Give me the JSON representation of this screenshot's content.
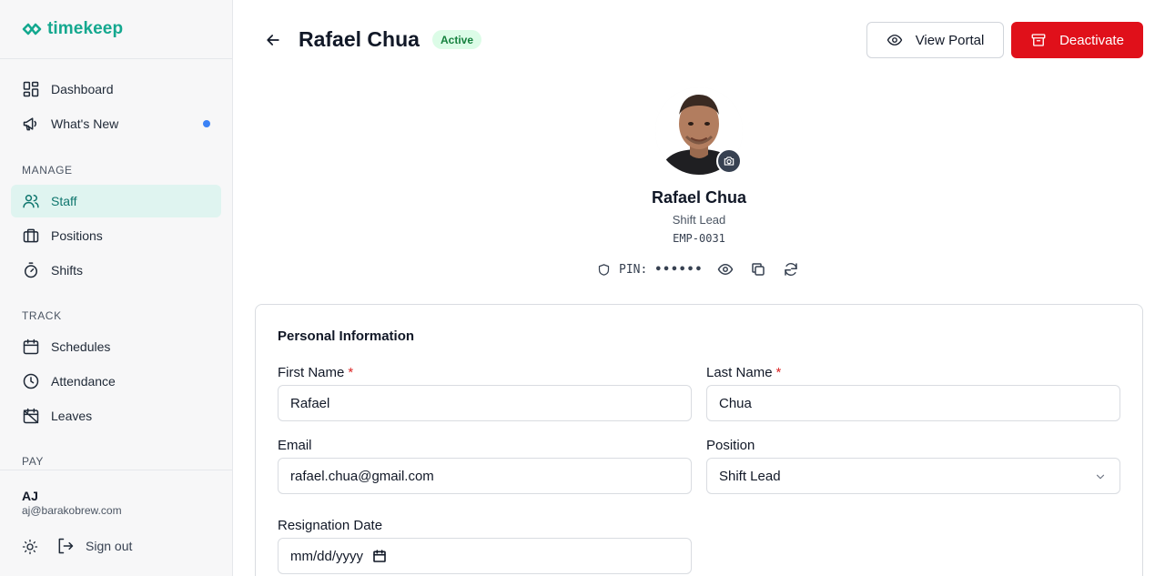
{
  "app": {
    "name": "timekeep"
  },
  "sidebar": {
    "top_items": [
      {
        "label": "Dashboard",
        "icon": "grid-icon"
      },
      {
        "label": "What's New",
        "icon": "megaphone-icon",
        "badge_dot": true
      }
    ],
    "sections": [
      {
        "label": "MANAGE",
        "items": [
          {
            "label": "Staff",
            "icon": "users-icon",
            "active": true
          },
          {
            "label": "Positions",
            "icon": "briefcase-icon"
          },
          {
            "label": "Shifts",
            "icon": "timer-icon"
          }
        ]
      },
      {
        "label": "TRACK",
        "items": [
          {
            "label": "Schedules",
            "icon": "calendar-icon"
          },
          {
            "label": "Attendance",
            "icon": "clock-icon"
          },
          {
            "label": "Leaves",
            "icon": "calendar-off-icon"
          }
        ]
      },
      {
        "label": "PAY",
        "items": []
      }
    ],
    "user": {
      "initials": "AJ",
      "email": "aj@barakobrew.com"
    },
    "signout_label": "Sign out"
  },
  "header": {
    "title": "Rafael Chua",
    "status": "Active",
    "view_portal_label": "View Portal",
    "deactivate_label": "Deactivate"
  },
  "profile": {
    "name": "Rafael Chua",
    "role": "Shift Lead",
    "employee_id": "EMP-0031",
    "pin_label": "PIN:",
    "pin_value": "••••••"
  },
  "personal_info": {
    "title": "Personal Information",
    "first_name": {
      "label": "First Name",
      "value": "Rafael",
      "required": true
    },
    "last_name": {
      "label": "Last Name",
      "value": "Chua",
      "required": true
    },
    "email": {
      "label": "Email",
      "value": "rafael.chua@gmail.com"
    },
    "position": {
      "label": "Position",
      "value": "Shift Lead"
    },
    "resignation_date": {
      "label": "Resignation Date",
      "placeholder": "mm/dd/yyyy"
    }
  },
  "colors": {
    "brand": "#14a88f",
    "active_nav_bg": "#dff4f0",
    "danger": "#e0101a",
    "status_active_bg": "#dcfce7",
    "status_active_text": "#15803d",
    "notification_dot": "#3b82f6"
  }
}
